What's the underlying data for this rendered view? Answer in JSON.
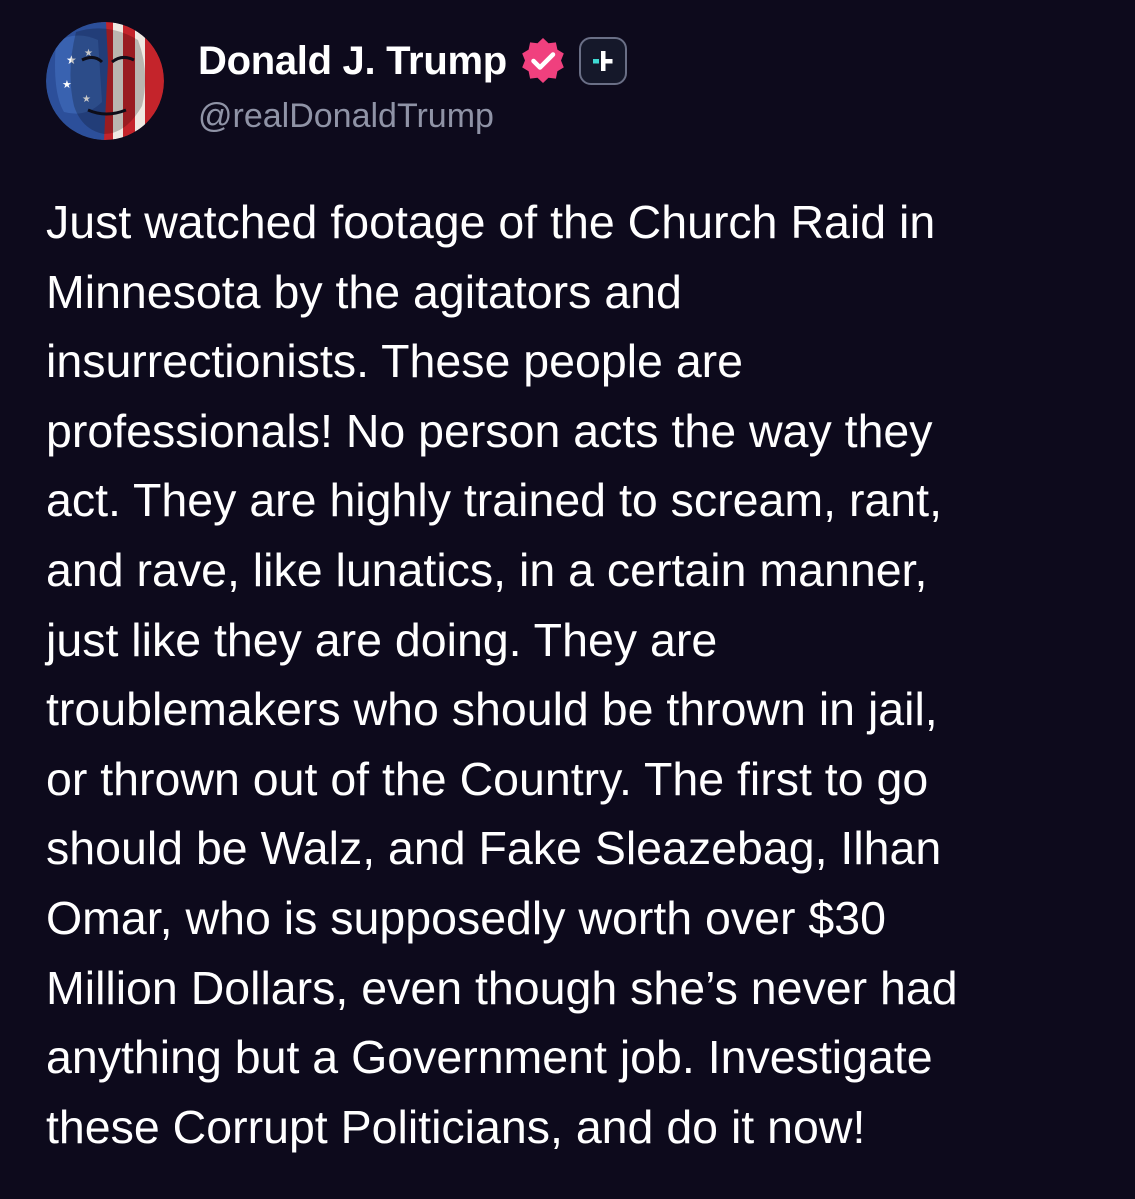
{
  "post": {
    "author": {
      "display_name": "Donald J. Trump",
      "handle": "@realDonaldTrump",
      "verified_icon": "verified-check-badge",
      "plus_icon": "plus-badge",
      "colors": {
        "verified": "#f0407e",
        "plus_accent": "#3fd9d2"
      }
    },
    "text_lines": [
      "Just watched footage of the Church Raid in",
      "Minnesota by the agitators and",
      "insurrectionists. These people are",
      "professionals! No person acts the way they",
      "act. They are highly trained to scream, rant,",
      "and rave, like lunatics, in a certain manner,",
      "just like they are doing. They are",
      "troublemakers who should be thrown in jail,",
      "or thrown out of the Country. The first to go",
      "should be Walz, and Fake Sleazebag, Ilhan",
      "Omar, who is supposedly worth over $30",
      "Million Dollars, even though she’s never had",
      "anything but a Government job. Investigate",
      "these Corrupt Politicians, and do it now!"
    ]
  },
  "theme": {
    "background": "#0d0a1c",
    "text": "#ffffff",
    "muted": "#8f93a6"
  }
}
